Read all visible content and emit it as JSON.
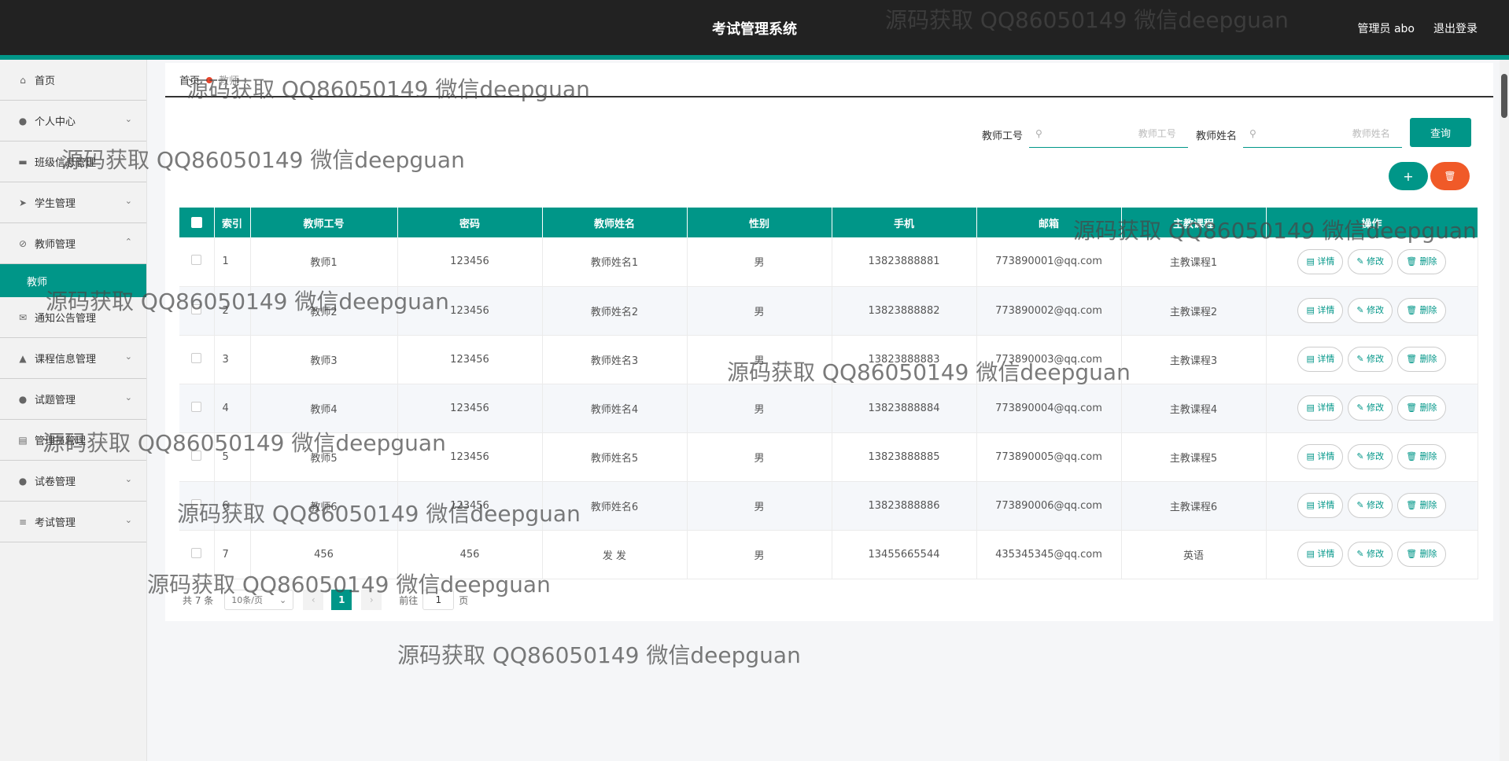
{
  "header": {
    "title": "考试管理系统",
    "user": "管理员 abo",
    "logout": "退出登录"
  },
  "sidebar": {
    "items": [
      {
        "label": "首页",
        "icon": "home-icon",
        "expandable": false
      },
      {
        "label": "个人中心",
        "icon": "user-icon",
        "expandable": true
      },
      {
        "label": "班级信息管理",
        "icon": "briefcase-icon",
        "expandable": false
      },
      {
        "label": "学生管理",
        "icon": "send-icon",
        "expandable": true
      },
      {
        "label": "教师管理",
        "icon": "bell-off-icon",
        "expandable": true,
        "expanded": true
      },
      {
        "label": "通知公告管理",
        "icon": "mail-icon",
        "expandable": false
      },
      {
        "label": "课程信息管理",
        "icon": "thumbs-up-icon",
        "expandable": true
      },
      {
        "label": "试题管理",
        "icon": "location-icon",
        "expandable": true
      },
      {
        "label": "管理员管理",
        "icon": "clipboard-icon",
        "expandable": false
      },
      {
        "label": "试卷管理",
        "icon": "user-icon",
        "expandable": true
      },
      {
        "label": "考试管理",
        "icon": "list-icon",
        "expandable": true
      }
    ],
    "sub_item": "教师"
  },
  "breadcrumb": {
    "home": "首页",
    "current": "教师"
  },
  "search": {
    "id_label": "教师工号",
    "id_placeholder": "教师工号",
    "name_label": "教师姓名",
    "name_placeholder": "教师姓名",
    "query_button": "查询"
  },
  "toolbar": {
    "add_symbol": "+",
    "delete_symbol": "🗑"
  },
  "table": {
    "columns": [
      "索引",
      "教师工号",
      "密码",
      "教师姓名",
      "性别",
      "手机",
      "邮箱",
      "主教课程",
      "操作"
    ],
    "rows": [
      {
        "idx": "1",
        "id": "教师1",
        "pwd": "123456",
        "name": "教师姓名1",
        "gender": "男",
        "phone": "13823888881",
        "email": "773890001@qq.com",
        "course": "主教课程1"
      },
      {
        "idx": "2",
        "id": "教师2",
        "pwd": "123456",
        "name": "教师姓名2",
        "gender": "男",
        "phone": "13823888882",
        "email": "773890002@qq.com",
        "course": "主教课程2"
      },
      {
        "idx": "3",
        "id": "教师3",
        "pwd": "123456",
        "name": "教师姓名3",
        "gender": "男",
        "phone": "13823888883",
        "email": "773890003@qq.com",
        "course": "主教课程3"
      },
      {
        "idx": "4",
        "id": "教师4",
        "pwd": "123456",
        "name": "教师姓名4",
        "gender": "男",
        "phone": "13823888884",
        "email": "773890004@qq.com",
        "course": "主教课程4"
      },
      {
        "idx": "5",
        "id": "教师5",
        "pwd": "123456",
        "name": "教师姓名5",
        "gender": "男",
        "phone": "13823888885",
        "email": "773890005@qq.com",
        "course": "主教课程5"
      },
      {
        "idx": "6",
        "id": "教师6",
        "pwd": "123456",
        "name": "教师姓名6",
        "gender": "男",
        "phone": "13823888886",
        "email": "773890006@qq.com",
        "course": "主教课程6"
      },
      {
        "idx": "7",
        "id": "456",
        "pwd": "456",
        "name": "发 发",
        "gender": "男",
        "phone": "13455665544",
        "email": "435345345@qq.com",
        "course": "英语"
      }
    ],
    "actions": {
      "detail": "详情",
      "edit": "修改",
      "delete": "删除"
    }
  },
  "pagination": {
    "total": "共 7 条",
    "page_size": "10条/页",
    "current_page": "1",
    "goto": "前往",
    "goto_value": "1",
    "unit": "页"
  },
  "watermark": "源码获取 QQ86050149 微信deepguan",
  "colors": {
    "primary": "#009688",
    "header_bg": "#222222",
    "danger": "#f05a28",
    "breadcrumb_dot": "#e8452c"
  }
}
